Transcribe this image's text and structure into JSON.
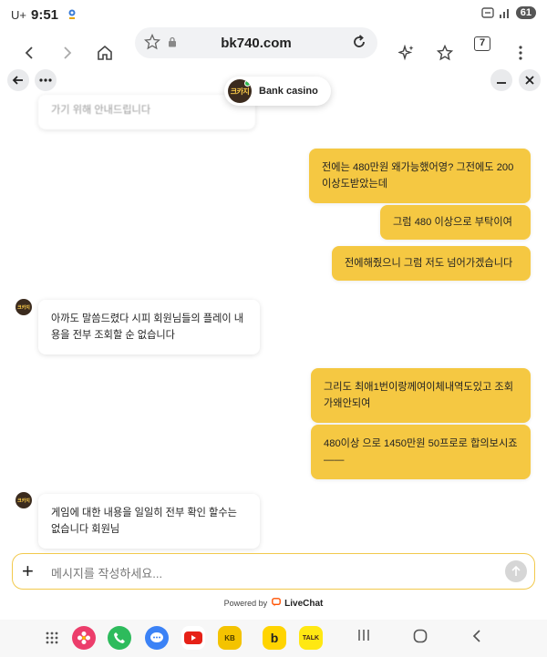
{
  "status_bar": {
    "carrier": "U+",
    "time": "9:51",
    "battery": "61"
  },
  "browser": {
    "url": "bk740.com",
    "tab_count": "7"
  },
  "agent": {
    "name": "Bank casino",
    "avatar_text": "크카지"
  },
  "messages": [
    {
      "side": "in",
      "text": "가기 위해 안내드립니다",
      "faded": true
    },
    {
      "side": "out",
      "text": "전에는 480만원 왜가능했어영? 그전에도 200이상도받았는데"
    },
    {
      "side": "out",
      "text": "그럼 480 이상으로 부탁이여"
    },
    {
      "side": "out",
      "text": "전에해줬으니 그럼 저도 넘어가겠습니다"
    },
    {
      "side": "in",
      "text": "아까도 말씀드렸다 시피 회원님들의 플레이 내용을 전부 조회할 순 없습니다"
    },
    {
      "side": "out",
      "text": "그리도 최애1번이랑께여이체내역도있고 조회가왜안되여"
    },
    {
      "side": "out",
      "text": "480이상 으로 1450만원 50프로로 합의보시죠 ——"
    },
    {
      "side": "in",
      "text": "게임에 대한 내용을 일일히 전부 확인 할수는 없습니다 회원님"
    }
  ],
  "composer": {
    "placeholder": "메시지를 작성하세요..."
  },
  "footer": {
    "powered_by": "Powered by",
    "brand": "LiveChat"
  },
  "dock": {
    "apps": [
      "apps-grid",
      "gallery",
      "phone",
      "messages",
      "youtube",
      "kb-bank",
      "kakaobank",
      "kakaotalk"
    ],
    "kb_label": "KB",
    "kakaobank_label": "b",
    "talk_label": "TALK"
  }
}
